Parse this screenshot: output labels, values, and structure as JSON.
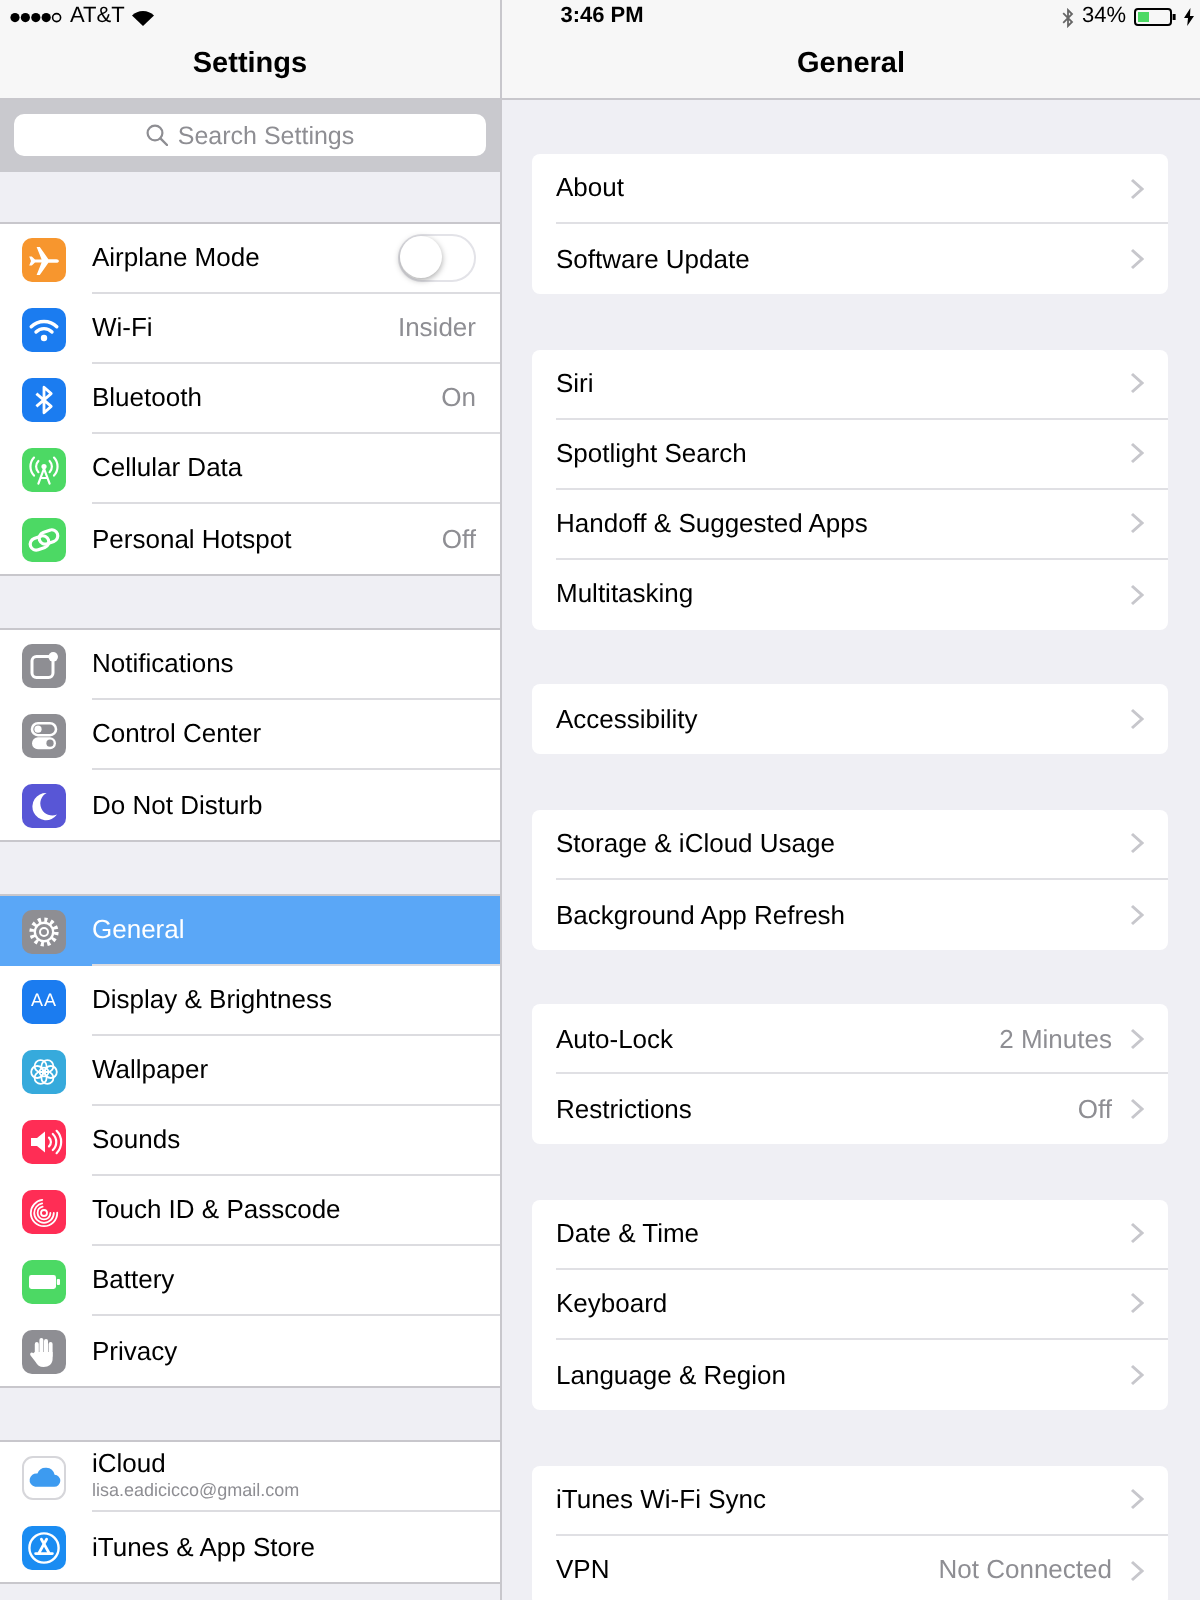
{
  "status_bar": {
    "carrier": "AT&T",
    "time": "3:46 PM",
    "battery": "34%"
  },
  "sidebar": {
    "title": "Settings",
    "search": {
      "placeholder": "Search Settings"
    },
    "groups": [
      {
        "items": [
          {
            "label": "Airplane Mode",
            "kind": "toggle",
            "on": false,
            "color": "#f7962e",
            "selected": false
          },
          {
            "label": "Wi-Fi",
            "kind": "link",
            "value": "Insider",
            "color": "#1b7cf0",
            "selected": false
          },
          {
            "label": "Bluetooth",
            "kind": "link",
            "value": "On",
            "color": "#1b7cf0",
            "selected": false
          },
          {
            "label": "Cellular Data",
            "kind": "link",
            "color": "#4cd964",
            "selected": false
          },
          {
            "label": "Personal Hotspot",
            "kind": "link",
            "value": "Off",
            "color": "#4cd964",
            "selected": false
          }
        ]
      },
      {
        "items": [
          {
            "label": "Notifications",
            "kind": "link",
            "color": "#8e8e93",
            "selected": false
          },
          {
            "label": "Control Center",
            "kind": "link",
            "color": "#8e8e93",
            "selected": false
          },
          {
            "label": "Do Not Disturb",
            "kind": "link",
            "color": "#5856d6",
            "selected": false
          }
        ]
      },
      {
        "items": [
          {
            "label": "General",
            "kind": "link",
            "color": "#8e8e93",
            "selected": true
          },
          {
            "label": "Display & Brightness",
            "kind": "link",
            "glyph": "AA",
            "color": "#1b7cf0",
            "selected": false
          },
          {
            "label": "Wallpaper",
            "kind": "link",
            "color": "#36aadc",
            "selected": false
          },
          {
            "label": "Sounds",
            "kind": "link",
            "color": "#ff2d55",
            "selected": false
          },
          {
            "label": "Touch ID & Passcode",
            "kind": "link",
            "color": "#ff2d55",
            "selected": false
          },
          {
            "label": "Battery",
            "kind": "link",
            "color": "#4cd964",
            "selected": false
          },
          {
            "label": "Privacy",
            "kind": "link",
            "color": "#8e8e93",
            "selected": false
          }
        ]
      },
      {
        "items": [
          {
            "label": "iCloud",
            "kind": "link",
            "subtitle": "lisa.eadicicco@gmail.com",
            "color": "#3d9bf0",
            "selected": false
          },
          {
            "label": "iTunes & App Store",
            "kind": "link",
            "color": "#1a8cf2",
            "selected": false
          }
        ]
      }
    ]
  },
  "detail": {
    "title": "General",
    "groups": [
      {
        "items": [
          {
            "label": "About"
          },
          {
            "label": "Software Update"
          }
        ]
      },
      {
        "items": [
          {
            "label": "Siri"
          },
          {
            "label": "Spotlight Search"
          },
          {
            "label": "Handoff & Suggested Apps"
          },
          {
            "label": "Multitasking"
          }
        ]
      },
      {
        "items": [
          {
            "label": "Accessibility"
          }
        ]
      },
      {
        "items": [
          {
            "label": "Storage & iCloud Usage"
          },
          {
            "label": "Background App Refresh"
          }
        ]
      },
      {
        "items": [
          {
            "label": "Auto-Lock",
            "value": "2 Minutes"
          },
          {
            "label": "Restrictions",
            "value": "Off"
          }
        ]
      },
      {
        "items": [
          {
            "label": "Date & Time"
          },
          {
            "label": "Keyboard"
          },
          {
            "label": "Language & Region"
          }
        ]
      },
      {
        "items": [
          {
            "label": "iTunes Wi-Fi Sync"
          },
          {
            "label": "VPN",
            "value": "Not Connected"
          }
        ]
      }
    ]
  }
}
